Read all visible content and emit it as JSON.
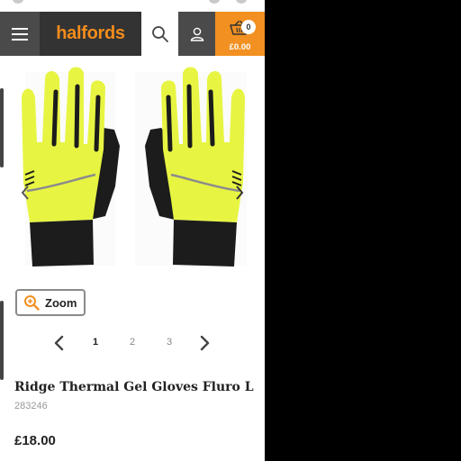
{
  "header": {
    "logo": "halfords",
    "basket_count": "0",
    "basket_total": "£0.00"
  },
  "gallery": {
    "zoom_label": "Zoom",
    "pages": [
      "1",
      "2",
      "3"
    ],
    "current_page": 1
  },
  "product": {
    "title": "Ridge Thermal Gel Gloves Fluro L",
    "sku": "283246",
    "price": "£18.00"
  },
  "colors": {
    "brand_orange": "#f29021",
    "header_dark": "#333333",
    "glove_fluro": "#e7f542"
  },
  "icons": [
    "hamburger-menu-icon",
    "search-icon",
    "user-icon",
    "basket-icon",
    "magnifier-plus-icon",
    "chevron-left-icon",
    "chevron-right-icon"
  ]
}
